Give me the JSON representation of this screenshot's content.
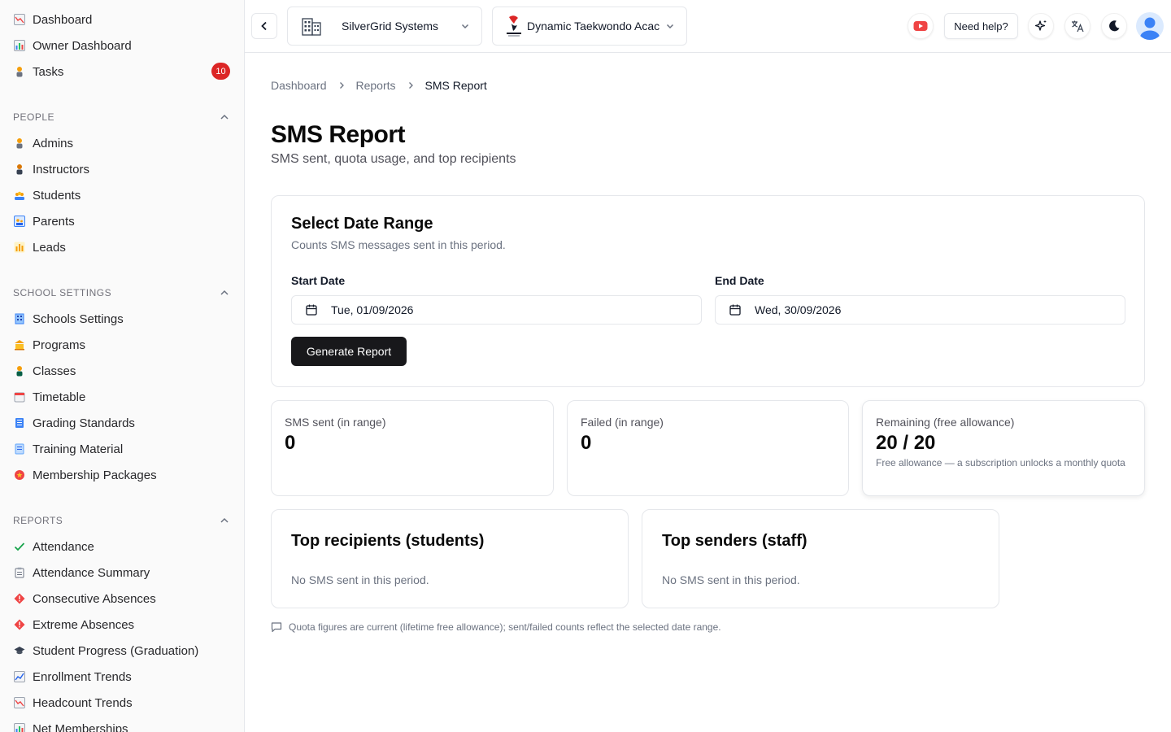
{
  "sidebar": {
    "top_items": [
      {
        "label": "Dashboard",
        "icon": "chart-down-icon"
      },
      {
        "label": "Owner Dashboard",
        "icon": "bar-chart-icon"
      },
      {
        "label": "Tasks",
        "icon": "person-icon",
        "badge": "10"
      }
    ],
    "groups": [
      {
        "title": "PEOPLE",
        "items": [
          {
            "label": "Admins",
            "icon": "person-icon"
          },
          {
            "label": "Instructors",
            "icon": "teacher-icon"
          },
          {
            "label": "Students",
            "icon": "group-icon"
          },
          {
            "label": "Parents",
            "icon": "family-icon"
          },
          {
            "label": "Leads",
            "icon": "chart-icon"
          }
        ]
      },
      {
        "title": "SCHOOL SETTINGS",
        "items": [
          {
            "label": "Schools Settings",
            "icon": "building-icon"
          },
          {
            "label": "Programs",
            "icon": "bank-icon"
          },
          {
            "label": "Classes",
            "icon": "student-icon"
          },
          {
            "label": "Timetable",
            "icon": "calendar-icon"
          },
          {
            "label": "Grading Standards",
            "icon": "book-icon"
          },
          {
            "label": "Training Material",
            "icon": "document-icon"
          },
          {
            "label": "Membership Packages",
            "icon": "medal-icon"
          }
        ]
      },
      {
        "title": "REPORTS",
        "items": [
          {
            "label": "Attendance",
            "icon": "check-icon"
          },
          {
            "label": "Attendance Summary",
            "icon": "clipboard-icon"
          },
          {
            "label": "Consecutive Absences",
            "icon": "warning-diamond-icon"
          },
          {
            "label": "Extreme Absences",
            "icon": "warning-diamond-icon"
          },
          {
            "label": "Student Progress (Graduation)",
            "icon": "graduation-cap-icon"
          },
          {
            "label": "Enrollment Trends",
            "icon": "trend-up-icon"
          },
          {
            "label": "Headcount Trends",
            "icon": "chart-down-icon"
          },
          {
            "label": "Net Memberships",
            "icon": "bar-chart-icon"
          }
        ]
      }
    ]
  },
  "topbar": {
    "company": "SilverGrid Systems",
    "school": "Dynamic Taekwondo Acac",
    "help_label": "Need help?"
  },
  "breadcrumb": [
    "Dashboard",
    "Reports",
    "SMS Report"
  ],
  "page": {
    "title": "SMS Report",
    "subtitle": "SMS sent, quota usage, and top recipients"
  },
  "date_range": {
    "title": "Select Date Range",
    "description": "Counts SMS messages sent in this period.",
    "start_label": "Start Date",
    "start_value": "Tue, 01/09/2026",
    "end_label": "End Date",
    "end_value": "Wed, 30/09/2026",
    "button_label": "Generate Report"
  },
  "stats": [
    {
      "label": "SMS sent (in range)",
      "value": "0",
      "note": ""
    },
    {
      "label": "Failed (in range)",
      "value": "0",
      "note": ""
    },
    {
      "label": "Remaining (free allowance)",
      "value": "20 / 20",
      "note": "Free allowance — a subscription unlocks a monthly quota"
    }
  ],
  "top_recipients": {
    "title": "Top recipients (students)",
    "empty": "No SMS sent in this period."
  },
  "top_senders": {
    "title": "Top senders (staff)",
    "empty": "No SMS sent in this period."
  },
  "footnote": "Quota figures are current (lifetime free allowance); sent/failed counts reflect the selected date range.",
  "colors": {
    "badge": "#dc2626",
    "primary_button": "#18181b",
    "youtube": "#ef4444",
    "avatar": "#60a5fa"
  }
}
